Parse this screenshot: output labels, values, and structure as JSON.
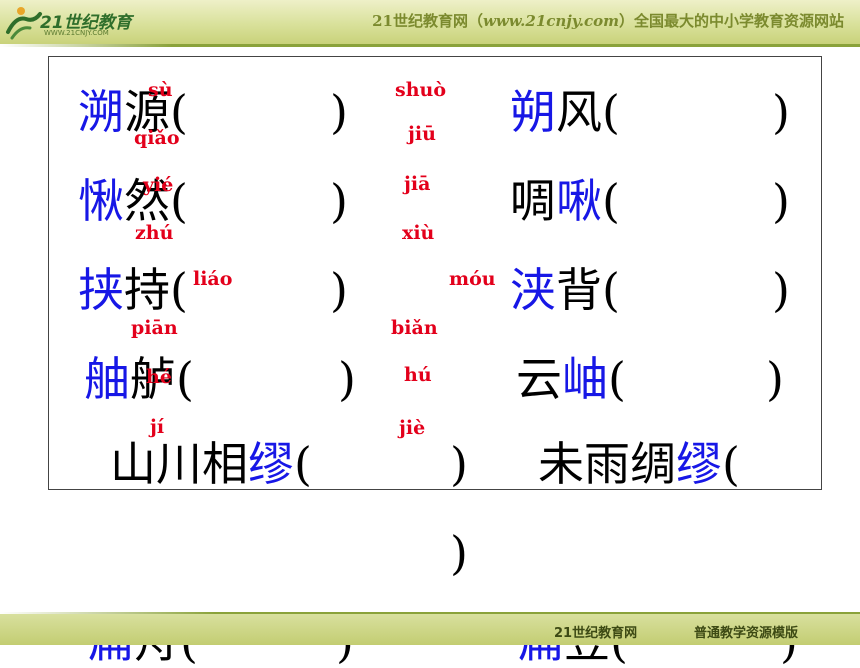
{
  "header": {
    "logo_text": "21世纪教育",
    "logo_sub": "WWW.21CNJY.COM",
    "slogan_prefix": "21世纪教育网（",
    "slogan_url": "www.21cnjy.com",
    "slogan_suffix": "）全国最大的中小学教育资源网站"
  },
  "items": [
    {
      "c1": "溯",
      "c2": "源",
      "open": "(",
      "close": ")"
    },
    {
      "c1": "朔",
      "c2": "风",
      "open": "(",
      "close": ")"
    },
    {
      "c1": "愀",
      "c2": "然",
      "open": "(",
      "close": ")"
    },
    {
      "c1": "啁",
      "c2": "啾",
      "open": "(",
      "close": ")"
    },
    {
      "c1": "挟",
      "c2": "持",
      "open": "(",
      "close": ")"
    },
    {
      "c1": "浃",
      "c2": "背",
      "open": "(",
      "close": ")"
    },
    {
      "c1": "舳",
      "c2": "舻",
      "open": "(",
      "close": ")"
    },
    {
      "c1": "云",
      "c2": "岫",
      "open": "(",
      "close": ")"
    },
    {
      "c1": "山川相",
      "c2": "缪",
      "open": "(",
      "close": ")"
    },
    {
      "c1": "未雨绸",
      "c2": "缪",
      "open": "(",
      "close": ")"
    },
    {
      "c1": "扁",
      "c2": "舟",
      "open": "(",
      "close": ")"
    },
    {
      "c1": "扁",
      "c2": "豆",
      "open": "(",
      "close": ")"
    }
  ],
  "pinyin": [
    "sù",
    "shuò",
    "qiǎo",
    "jiū",
    "yié",
    "jiā",
    "zhú",
    "xiù",
    "liáo",
    "móu",
    "piān",
    "biǎn",
    "hé",
    "hú",
    "jí",
    "jiè"
  ],
  "footer": {
    "left": "21世纪教育网",
    "right": "普通教学资源模版"
  }
}
